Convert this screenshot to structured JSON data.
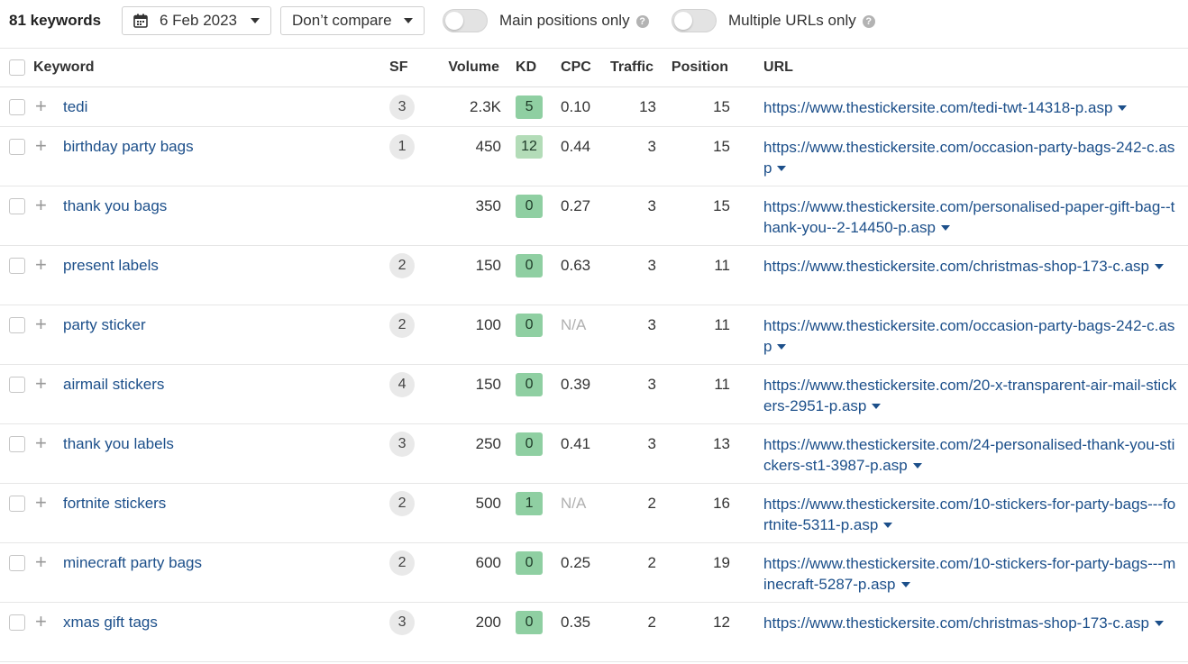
{
  "toolbar": {
    "keyword_count": "81 keywords",
    "date_label": "6 Feb 2023",
    "compare_label": "Don’t compare",
    "main_positions_label": "Main positions only",
    "multiple_urls_label": "Multiple URLs only",
    "help_glyph": "?"
  },
  "columns": {
    "keyword": "Keyword",
    "sf": "SF",
    "volume": "Volume",
    "kd": "KD",
    "cpc": "CPC",
    "traffic": "Traffic",
    "position": "Position",
    "url": "URL"
  },
  "rows": [
    {
      "keyword": "tedi",
      "sf": "3",
      "volume": "2.3K",
      "kd": "5",
      "cpc": "0.10",
      "traffic": "13",
      "position": "15",
      "url": "https://www.thestickersite.com/tedi-twt-14318-p.asp"
    },
    {
      "keyword": "birthday party bags",
      "sf": "1",
      "volume": "450",
      "kd": "12",
      "cpc": "0.44",
      "traffic": "3",
      "position": "15",
      "url": "https://www.thestickersite.com/occasion-party-bags-242-c.asp"
    },
    {
      "keyword": "thank you bags",
      "sf": "",
      "volume": "350",
      "kd": "0",
      "cpc": "0.27",
      "traffic": "3",
      "position": "15",
      "url": "https://www.thestickersite.com/personalised-paper-gift-bag--thank-you--2-14450-p.asp"
    },
    {
      "keyword": "present labels",
      "sf": "2",
      "volume": "150",
      "kd": "0",
      "cpc": "0.63",
      "traffic": "3",
      "position": "11",
      "url": "https://www.thestickersite.com/christmas-shop-173-c.asp"
    },
    {
      "keyword": "party sticker",
      "sf": "2",
      "volume": "100",
      "kd": "0",
      "cpc": "N/A",
      "traffic": "3",
      "position": "11",
      "url": "https://www.thestickersite.com/occasion-party-bags-242-c.asp"
    },
    {
      "keyword": "airmail stickers",
      "sf": "4",
      "volume": "150",
      "kd": "0",
      "cpc": "0.39",
      "traffic": "3",
      "position": "11",
      "url": "https://www.thestickersite.com/20-x-transparent-air-mail-stickers-2951-p.asp"
    },
    {
      "keyword": "thank you labels",
      "sf": "3",
      "volume": "250",
      "kd": "0",
      "cpc": "0.41",
      "traffic": "3",
      "position": "13",
      "url": "https://www.thestickersite.com/24-personalised-thank-you-stickers-st1-3987-p.asp"
    },
    {
      "keyword": "fortnite stickers",
      "sf": "2",
      "volume": "500",
      "kd": "1",
      "cpc": "N/A",
      "traffic": "2",
      "position": "16",
      "url": "https://www.thestickersite.com/10-stickers-for-party-bags---fortnite-5311-p.asp"
    },
    {
      "keyword": "minecraft party bags",
      "sf": "2",
      "volume": "600",
      "kd": "0",
      "cpc": "0.25",
      "traffic": "2",
      "position": "19",
      "url": "https://www.thestickersite.com/10-stickers-for-party-bags---minecraft-5287-p.asp"
    },
    {
      "keyword": "xmas gift tags",
      "sf": "3",
      "volume": "200",
      "kd": "0",
      "cpc": "0.35",
      "traffic": "2",
      "position": "12",
      "url": "https://www.thestickersite.com/christmas-shop-173-c.asp"
    }
  ],
  "colors": {
    "link": "#1c4f8a",
    "kd_easy": "#8fcfa2",
    "kd_light": "#b3dcb8"
  }
}
